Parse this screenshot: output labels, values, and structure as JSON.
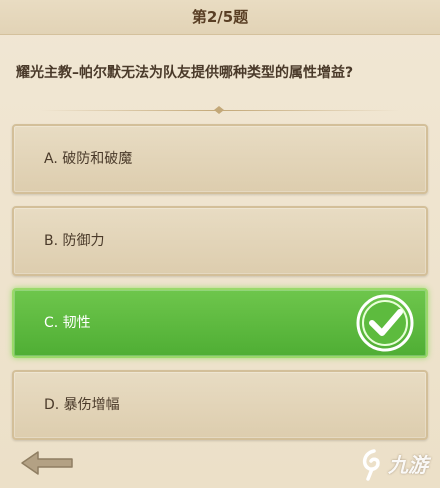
{
  "header": {
    "title": "第2/5题"
  },
  "question": {
    "text": "耀光主教–帕尔默无法为队友提供哪种类型的属性增益?"
  },
  "options": [
    {
      "label": "A. 破防和破魔",
      "correct": false
    },
    {
      "label": "B. 防御力",
      "correct": false
    },
    {
      "label": "C. 韧性",
      "correct": true
    },
    {
      "label": "D. 暴伤增幅",
      "correct": false
    }
  ],
  "footer": {
    "back_icon": "back-arrow-icon"
  },
  "watermark": {
    "text": "九游"
  },
  "colors": {
    "correct_green": "#5bb83d",
    "option_beige": "#e3d5b8",
    "text_brown": "#4a3a2a",
    "header_text": "#5a3f25"
  }
}
